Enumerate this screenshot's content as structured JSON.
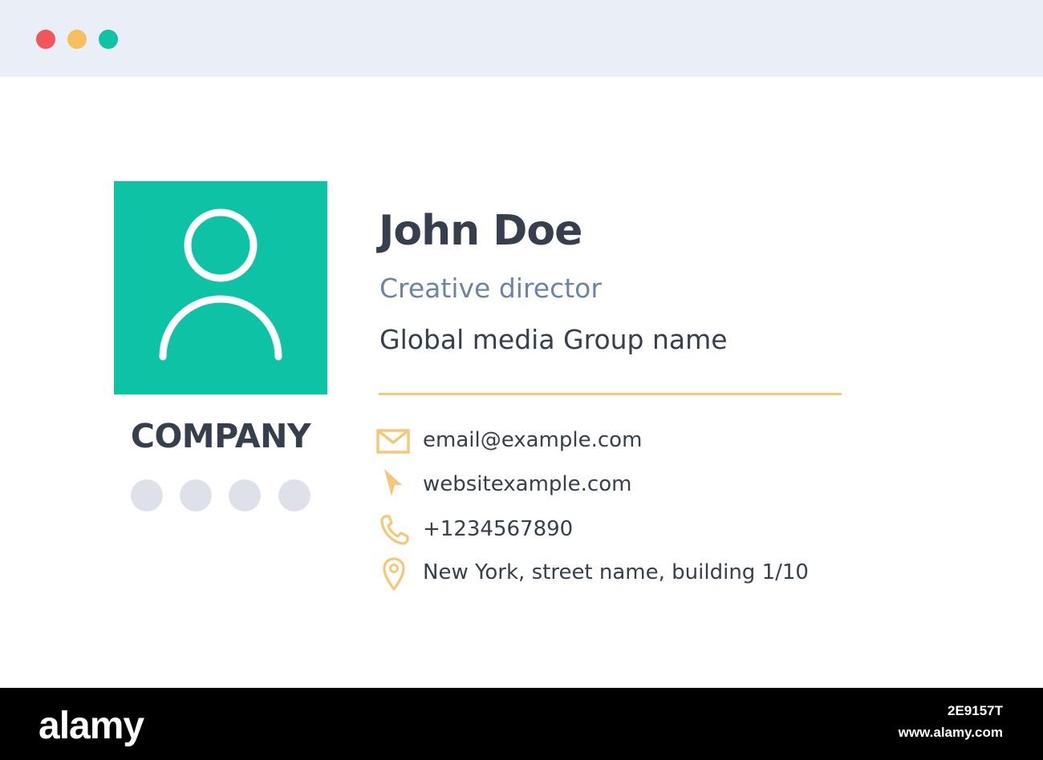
{
  "colors": {
    "titlebar_bg": "#eaeef6",
    "dot_close": "#f0565a",
    "dot_minimize": "#f7bf5e",
    "dot_maximize": "#10c3a4",
    "avatar_bg": "#0dc2a5",
    "accent": "#f5c779",
    "name_text": "#36404d",
    "title_text": "#6b85a3",
    "social_dot": "#dfe1ea"
  },
  "window": {
    "controls": [
      "close-dot",
      "minimize-dot",
      "maximize-dot"
    ]
  },
  "profile": {
    "avatar_icon": "user-icon",
    "company_logo": "COMPANY",
    "social_count": 4,
    "name": "John Doe",
    "title": "Creative director",
    "company_name": "Global media Group name"
  },
  "contacts": [
    {
      "icon": "envelope-icon",
      "text": "email@example.com"
    },
    {
      "icon": "cursor-icon",
      "text": "websitexample.com"
    },
    {
      "icon": "phone-icon",
      "text": "+1234567890"
    },
    {
      "icon": "location-pin-icon",
      "text": "New York, street name, building 1/10"
    }
  ],
  "watermark": {
    "logo": "alamy",
    "image_id": "2E9157T",
    "url": "www.alamy.com"
  }
}
